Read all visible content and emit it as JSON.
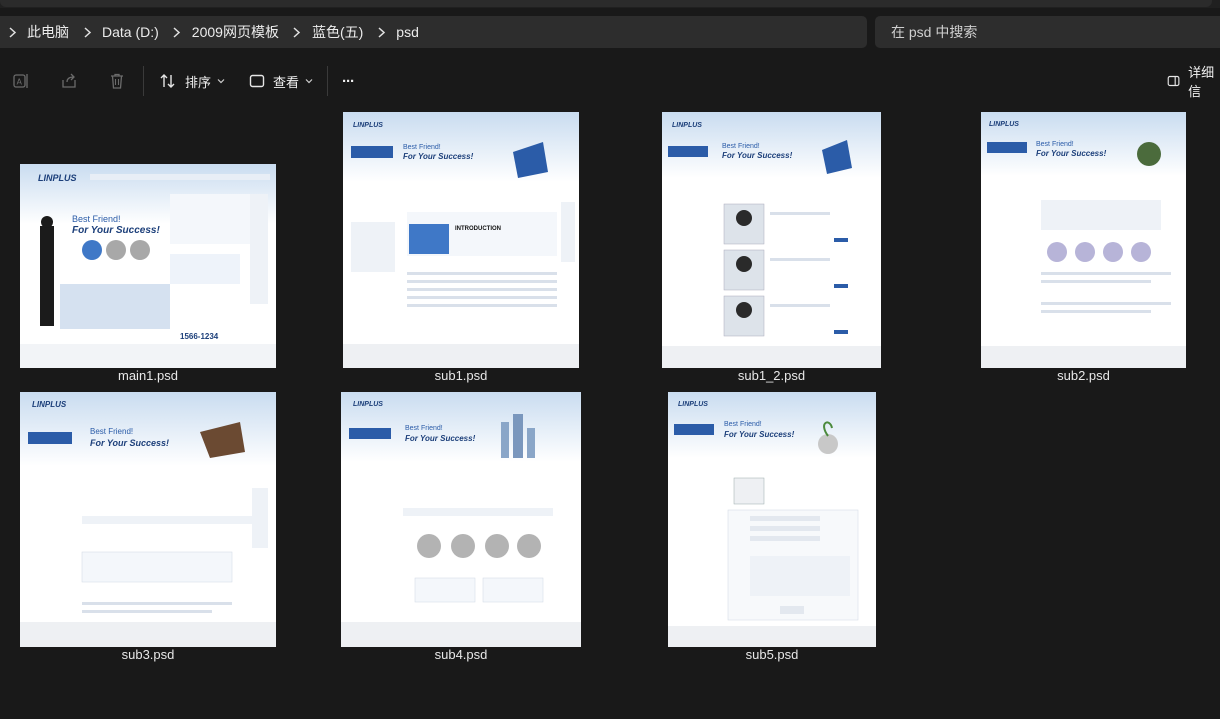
{
  "breadcrumb": {
    "items": [
      "此电脑",
      "Data (D:)",
      "2009网页模板",
      "蓝色(五)",
      "psd"
    ]
  },
  "search": {
    "placeholder": "在 psd 中搜索"
  },
  "toolbar": {
    "sort_label": "排序",
    "view_label": "查看",
    "more_label": "···",
    "details_label": "详细信"
  },
  "thumb_text": {
    "best_friend": "Best Friend!",
    "for_your_success": "For Your Success!",
    "introduction": "INTRODUCTION",
    "phone": "1566-1234"
  },
  "files": [
    {
      "name": "main1.psd"
    },
    {
      "name": "sub1.psd"
    },
    {
      "name": "sub1_2.psd"
    },
    {
      "name": "sub2.psd"
    },
    {
      "name": "sub3.psd"
    },
    {
      "name": "sub4.psd"
    },
    {
      "name": "sub5.psd"
    }
  ],
  "colors": {
    "background": "#191919",
    "bar": "#2d2d2d",
    "text": "#e6e6e6",
    "thumb_blue": "#2b5ca8",
    "thumb_dark": "#1c3f7a"
  }
}
